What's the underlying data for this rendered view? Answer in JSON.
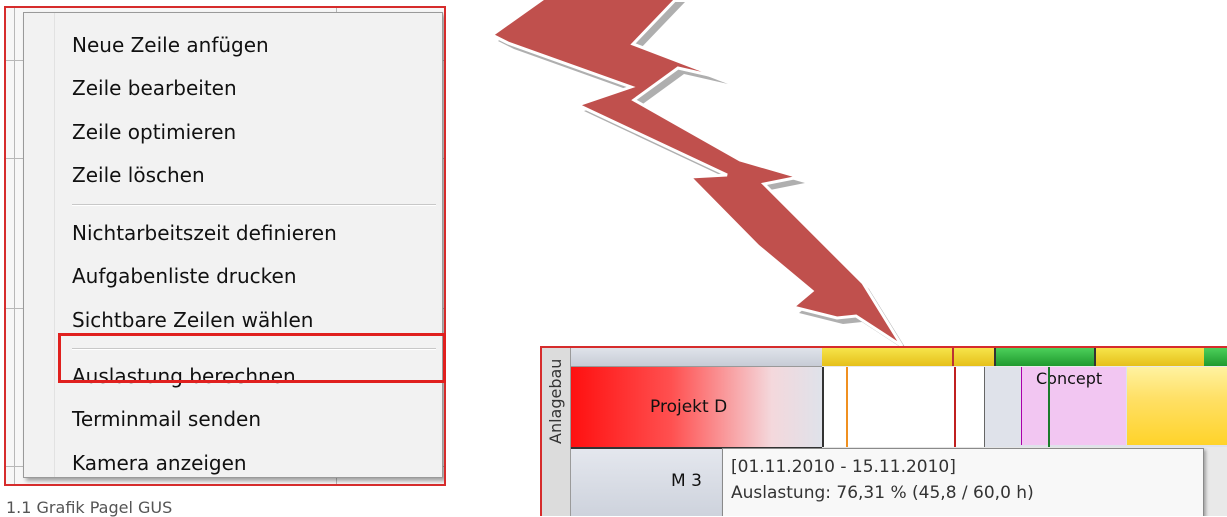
{
  "menu": {
    "items": [
      {
        "label": "Neue Zeile anfügen"
      },
      {
        "label": "Zeile bearbeiten"
      },
      {
        "label": "Zeile optimieren"
      },
      {
        "label": "Zeile löschen"
      },
      {
        "label": "Nichtarbeitszeit definieren"
      },
      {
        "label": "Aufgabenliste drucken"
      },
      {
        "label": "Sichtbare Zeilen wählen"
      },
      {
        "label": "Auslastung berechnen"
      },
      {
        "label": "Terminmail senden"
      },
      {
        "label": "Kamera anzeigen"
      }
    ],
    "highlighted_item": "Auslastung berechnen"
  },
  "caption": "1.1 Grafik Pagel GUS",
  "gantt": {
    "side_label": "Anlagebau",
    "project_label": "Projekt D",
    "resource_label": "M 3",
    "task_label": "Concept",
    "tooltip": {
      "line1": "[01.11.2010 - 15.11.2010]",
      "line2": "Auslastung: 76,31 %  (45,8 / 60,0 h)"
    }
  },
  "colors": {
    "highlight": "#e0201e",
    "arrow_fill": "#c0504d",
    "project_bar": "#ff1010",
    "task_fill": "#f2c6f2",
    "bar_yellow": "#ffd32a",
    "bar_green": "#2eaa3a"
  }
}
